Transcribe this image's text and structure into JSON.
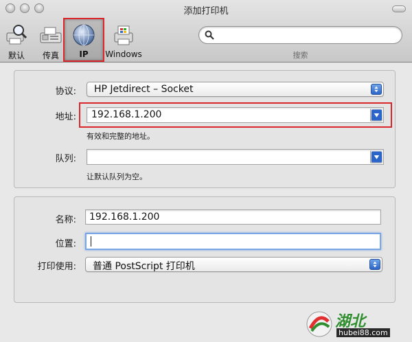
{
  "window": {
    "title": "添加打印机"
  },
  "toolbar": {
    "items": [
      {
        "label": "默认",
        "icon": "magnifier-printer-icon"
      },
      {
        "label": "传真",
        "icon": "fax-icon"
      },
      {
        "label": "IP",
        "icon": "globe-icon",
        "selected": true
      },
      {
        "label": "Windows",
        "icon": "windows-printer-icon"
      }
    ],
    "search": {
      "value": "",
      "label": "搜索"
    }
  },
  "form": {
    "protocol": {
      "label": "协议:",
      "value": "HP Jetdirect – Socket"
    },
    "address": {
      "label": "地址:",
      "value": "192.168.1.200",
      "hint": "有效和完整的地址。"
    },
    "queue": {
      "label": "队列:",
      "value": "",
      "hint": "让默认队列为空。"
    },
    "name": {
      "label": "名称:",
      "value": "192.168.1.200"
    },
    "location": {
      "label": "位置:",
      "value": ""
    },
    "print_using": {
      "label": "打印使用:",
      "value": "普通 PostScript 打印机"
    }
  },
  "watermark": {
    "text": "湖北",
    "url": "hubei88.com"
  },
  "colors": {
    "highlight": "#d9262b",
    "accent": "#2c65c9",
    "focus": "#7aa7e3"
  }
}
